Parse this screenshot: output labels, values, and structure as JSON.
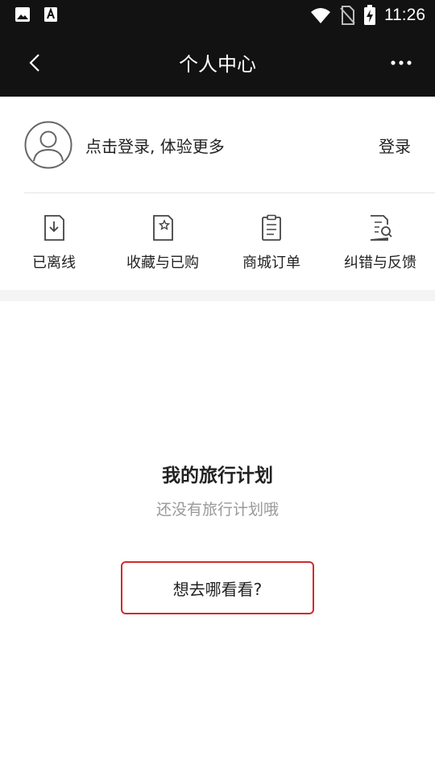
{
  "status_bar": {
    "time": "11:26",
    "left_icons": [
      "image-icon",
      "a-icon"
    ],
    "right_icons": [
      "wifi-icon",
      "no-sim-icon",
      "battery-charging-icon"
    ]
  },
  "header": {
    "title": "个人中心",
    "back_icon": "chevron-left-icon",
    "more_icon": "more-icon"
  },
  "profile": {
    "prompt": "点击登录, 体验更多",
    "login_label": "登录",
    "avatar_icon": "avatar-icon"
  },
  "shortcuts": [
    {
      "label": "已离线",
      "icon": "download-doc-icon"
    },
    {
      "label": "收藏与已购",
      "icon": "star-doc-icon"
    },
    {
      "label": "商城订单",
      "icon": "clipboard-icon"
    },
    {
      "label": "纠错与反馈",
      "icon": "search-doc-icon"
    }
  ],
  "travel_plan": {
    "title": "我的旅行计划",
    "subtitle": "还没有旅行计划哦",
    "button_label": "想去哪看看?"
  },
  "colors": {
    "header_bg": "#121212",
    "accent": "#d22a2a",
    "muted_text": "#999999",
    "section_gap": "#f4f4f4"
  }
}
